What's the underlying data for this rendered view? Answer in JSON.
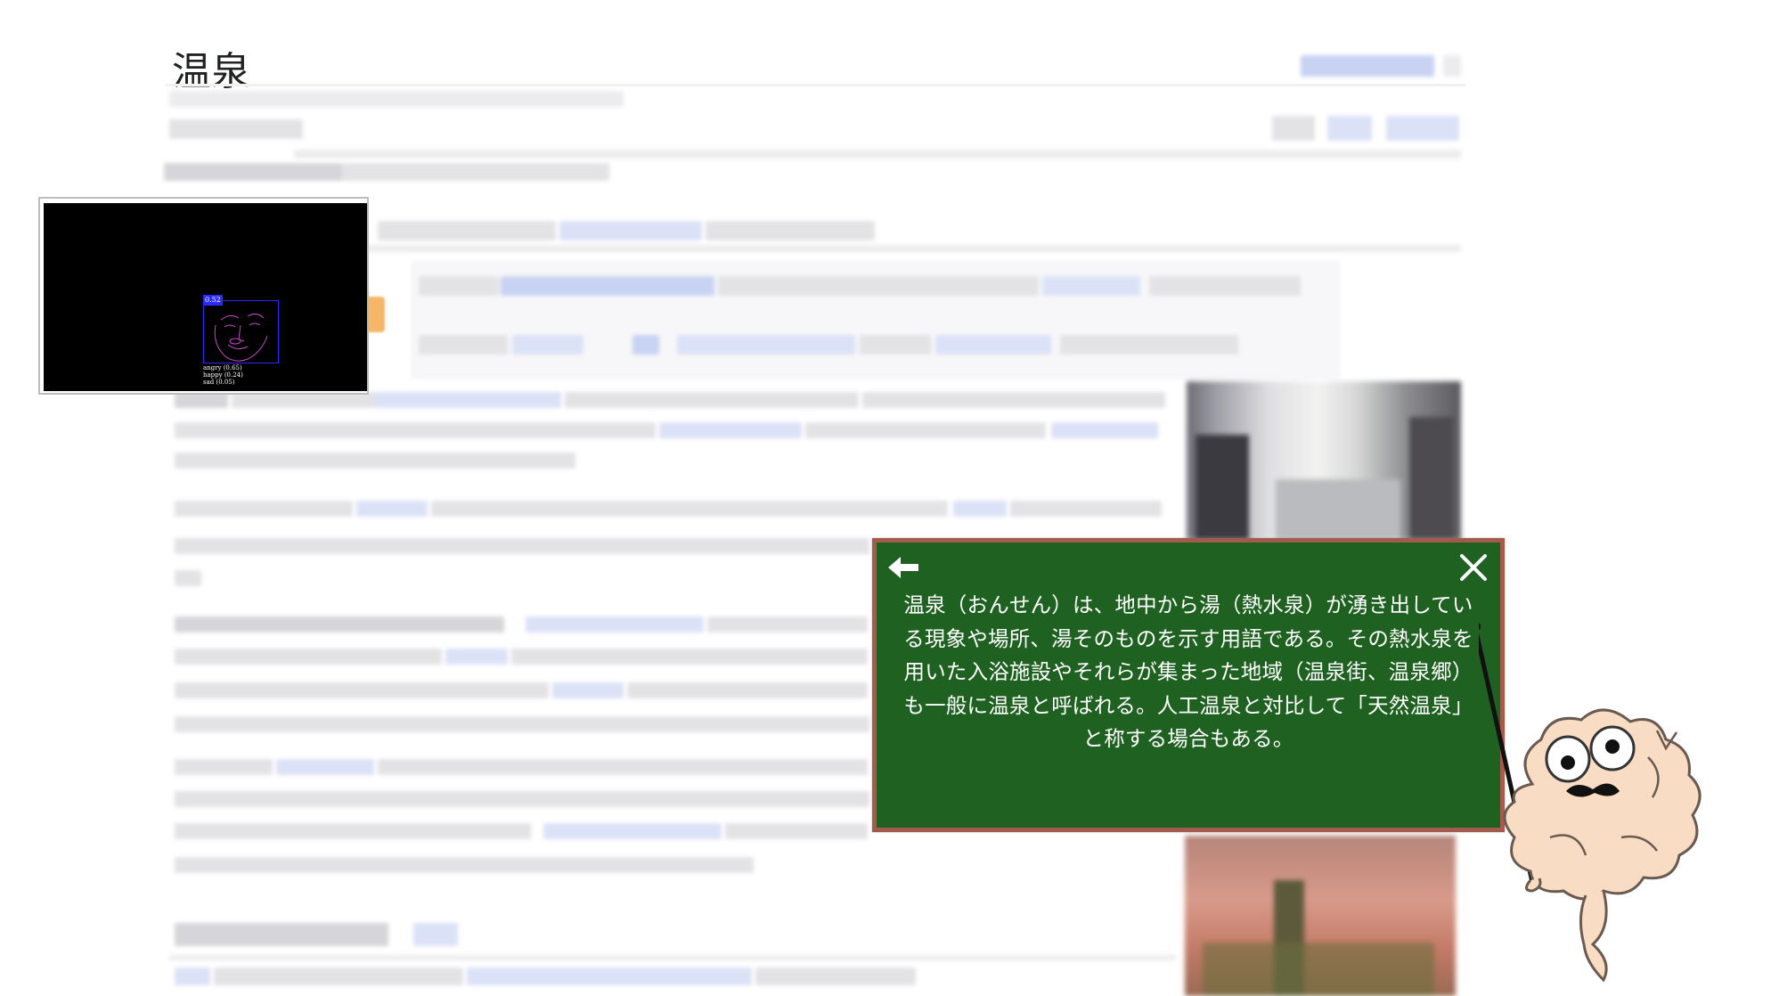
{
  "page": {
    "title": "温泉"
  },
  "chalkboard": {
    "text": "温泉（おんせん）は、地中から湯（熱水泉）が湧き出している現象や場所、湯そのものを示す用語である。その熱水泉を用いた入浴施設やそれらが集まった地域（温泉街、温泉郷）も一般に温泉と呼ばれる。人工温泉と対比して「天然温泉」と称する場合もある。",
    "back_icon": "arrow-left-icon",
    "close_icon": "close-icon",
    "background_color": "#1f6121",
    "border_color": "#a45b4c"
  },
  "webcam": {
    "face_score": "0.52",
    "emotions": [
      "angry (0.65)",
      "happy (0.24)",
      "sad (0.05)"
    ],
    "box_color": "#2a2aff"
  },
  "mascot": {
    "icon": "brain-professor-mascot-icon"
  }
}
